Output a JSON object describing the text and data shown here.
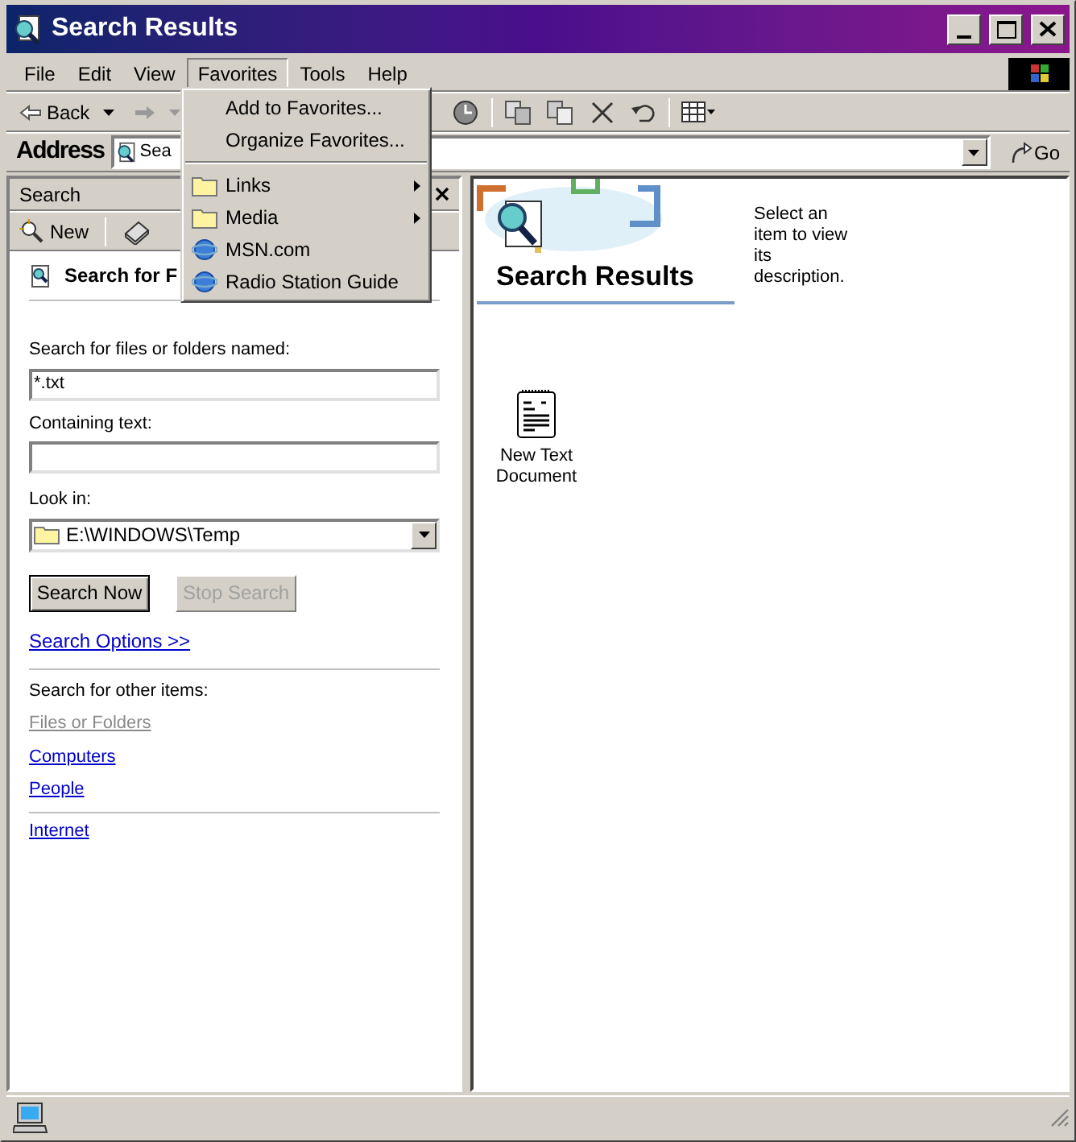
{
  "window": {
    "title": "Search Results"
  },
  "menu_bar": [
    {
      "label": "File",
      "selected": false
    },
    {
      "label": "Edit",
      "selected": false
    },
    {
      "label": "View",
      "selected": false
    },
    {
      "label": "Favorites",
      "selected": true
    },
    {
      "label": "Tools",
      "selected": false
    },
    {
      "label": "Help",
      "selected": false
    }
  ],
  "toolbar": {
    "back": "Back"
  },
  "address_bar": {
    "label": "Address",
    "value": "Sea",
    "go": "Go"
  },
  "favorites_menu": [
    {
      "kind": "command",
      "label": "Add to Favorites..."
    },
    {
      "kind": "command",
      "label": "Organize Favorites..."
    },
    {
      "kind": "separator"
    },
    {
      "kind": "folder",
      "label": "Links"
    },
    {
      "kind": "folder",
      "label": "Media"
    },
    {
      "kind": "link",
      "label": "MSN.com"
    },
    {
      "kind": "link",
      "label": "Radio Station Guide"
    }
  ],
  "search_pane": {
    "title": "Search",
    "new_button": "New",
    "heading": "Search for F",
    "named_label": "Search for files or folders named:",
    "named_value": "*.txt",
    "containing_label": "Containing text:",
    "look_in_label": "Look in:",
    "look_in_value": "E:\\WINDOWS\\Temp",
    "buttons": [
      {
        "label": "Search Now",
        "disabled": false
      },
      {
        "label": "Stop Search",
        "disabled": true
      }
    ],
    "options_link": "Search Options >>",
    "other_label": "Search for other items:",
    "other_items": [
      {
        "label": "Files or Folders",
        "disabled": true
      },
      {
        "label": "Computers",
        "disabled": false
      },
      {
        "label": "People",
        "disabled": false
      }
    ],
    "internet_link": "Internet"
  },
  "results": {
    "heading": "Search Results",
    "description": "Select an item to view its description.",
    "files": [
      {
        "name": "New Text Document"
      }
    ]
  }
}
